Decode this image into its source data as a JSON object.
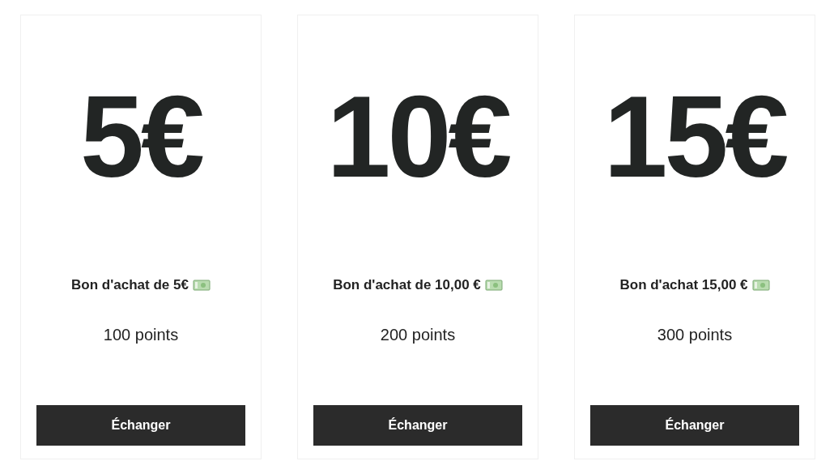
{
  "vouchers": [
    {
      "amount": "5€",
      "title": "Bon d'achat de 5€",
      "points": "100 points",
      "button": "Échanger"
    },
    {
      "amount": "10€",
      "title": "Bon d'achat de 10,00 €",
      "points": "200 points",
      "button": "Échanger"
    },
    {
      "amount": "15€",
      "title": "Bon d'achat 15,00 €",
      "points": "300 points",
      "button": "Échanger"
    }
  ]
}
